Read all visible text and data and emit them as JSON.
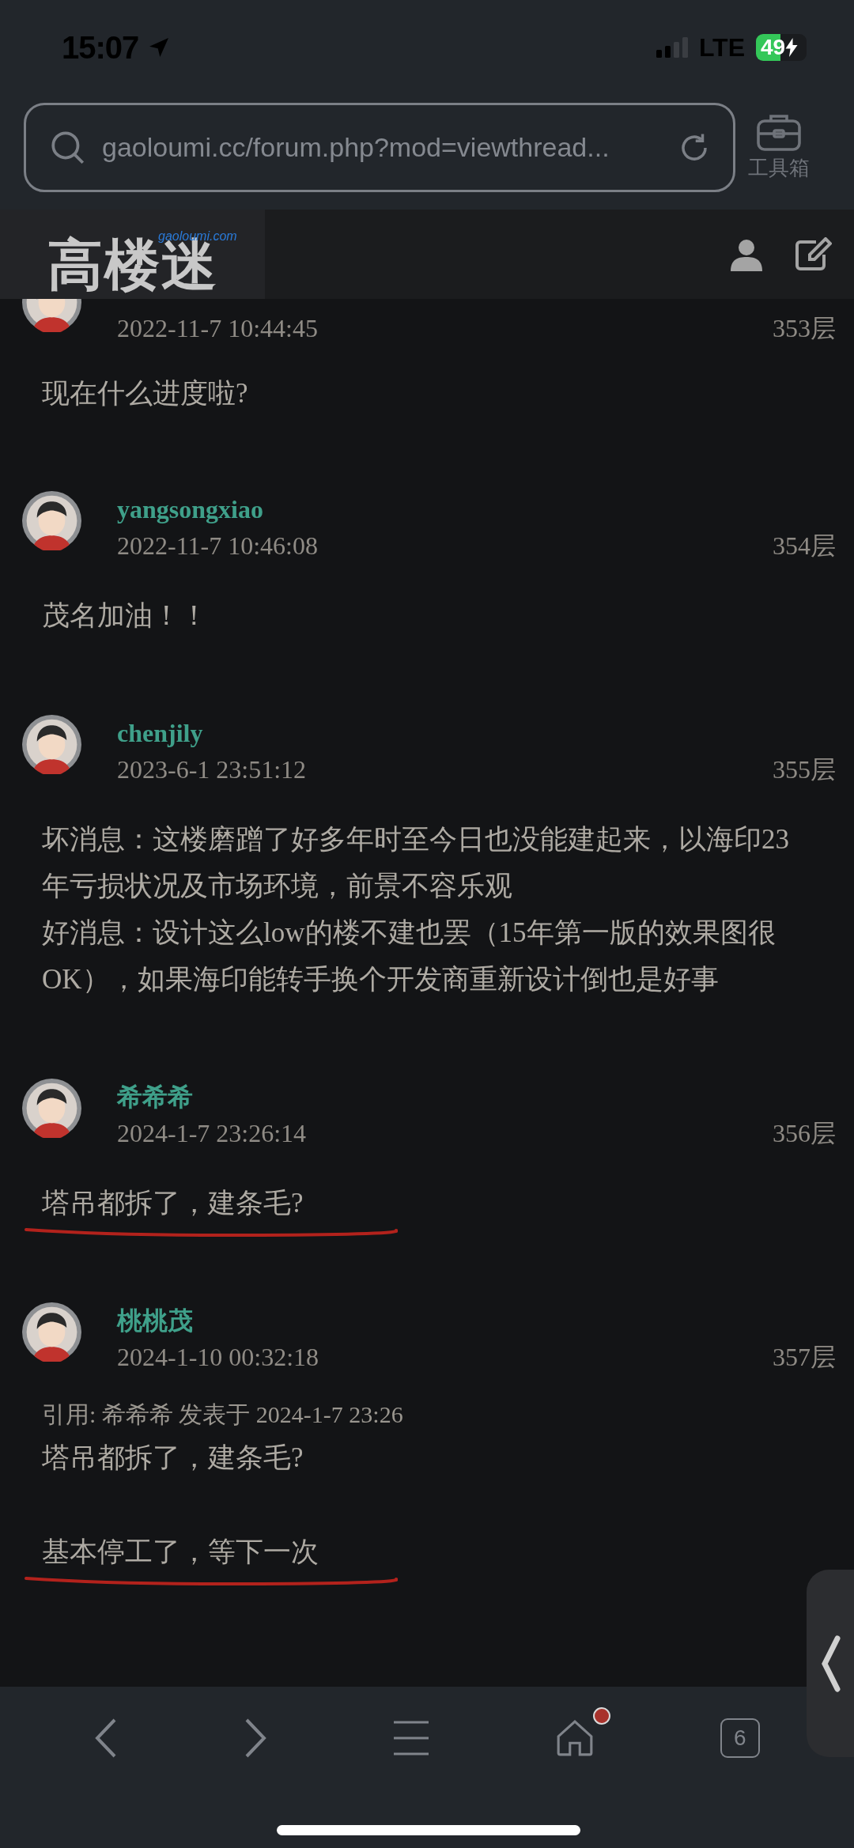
{
  "status_bar": {
    "time": "15:07",
    "network": "LTE",
    "battery": "49"
  },
  "address_bar": {
    "url": "gaoloumi.cc/forum.php?mod=viewthread...",
    "toolbox_label": "工具箱"
  },
  "site_header": {
    "logo_text": "高楼迷",
    "logo_domain": "gaoloumi.com"
  },
  "posts": [
    {
      "date": "2022-11-7 10:44:45",
      "floor": "353层",
      "body": [
        "现在什么进度啦?"
      ],
      "underlined": false
    },
    {
      "user": "yangsongxiao",
      "date": "2022-11-7 10:46:08",
      "floor": "354层",
      "body": [
        "茂名加油！！"
      ],
      "underlined": false
    },
    {
      "user": "chenjily",
      "date": "2023-6-1 23:51:12",
      "floor": "355层",
      "body": [
        "坏消息：这楼磨蹭了好多年时至今日也没能建起来，以海印23年亏损状况及市场环境，前景不容乐观",
        "好消息：设计这么low的楼不建也罢（15年第一版的效果图很OK），如果海印能转手换个开发商重新设计倒也是好事"
      ],
      "underlined": false
    },
    {
      "user": "希希希",
      "date": "2024-1-7 23:26:14",
      "floor": "356层",
      "body": [
        "塔吊都拆了，建条毛?"
      ],
      "underlined": true
    },
    {
      "user": "桃桃茂",
      "date": "2024-1-10 00:32:18",
      "floor": "357层",
      "quote": {
        "header": "引用: 希希希 发表于 2024-1-7 23:26",
        "text": "塔吊都拆了，建条毛?"
      },
      "body": [
        "基本停工了，等下一次"
      ],
      "underlined": true
    }
  ],
  "bottom_bar": {
    "tabs_count": "6",
    "home_badge": true
  }
}
